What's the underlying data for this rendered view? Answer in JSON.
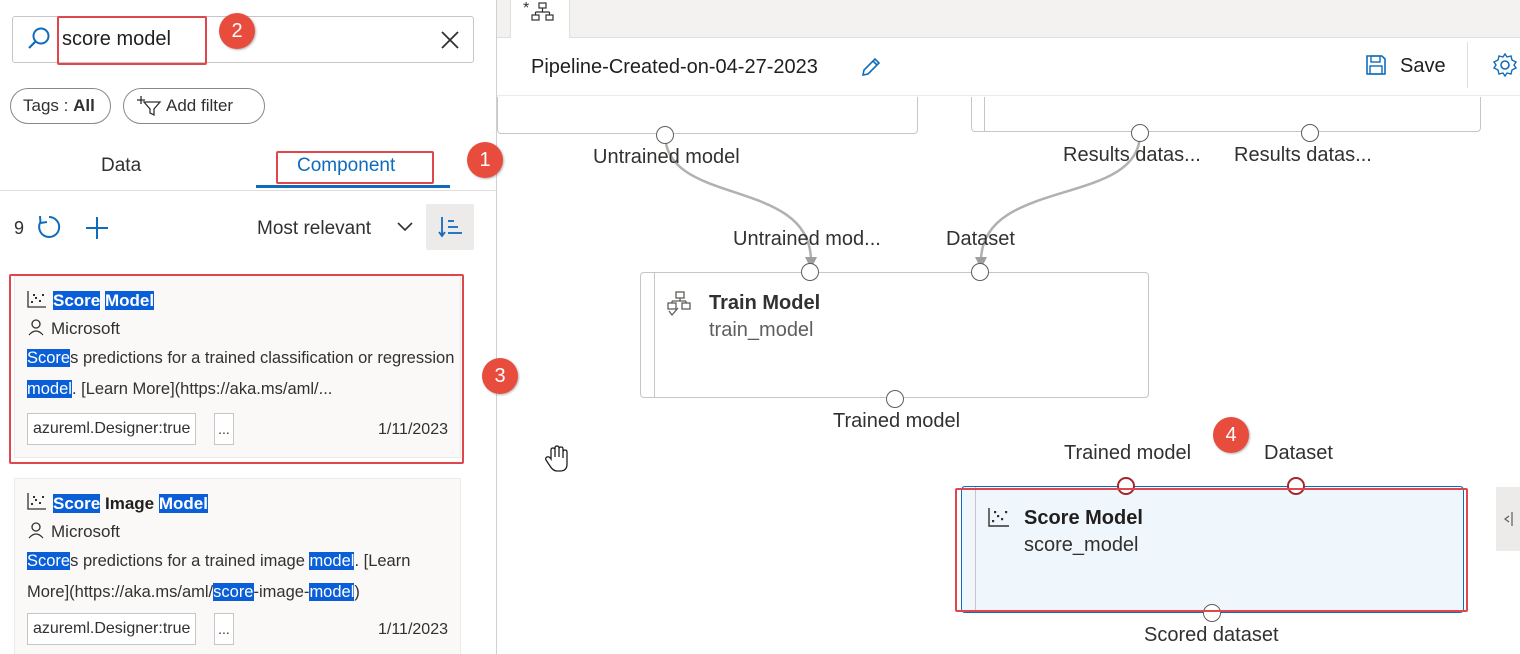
{
  "search": {
    "value": "score model"
  },
  "filters": {
    "tags_label": "Tags : ",
    "tags_value": "All",
    "add_filter": "Add filter"
  },
  "tabs": [
    {
      "label": "Data"
    },
    {
      "label": "Component"
    }
  ],
  "list_controls": {
    "count": "9",
    "sort": "Most relevant"
  },
  "cards": [
    {
      "title_parts": [
        "Score",
        "Model"
      ],
      "owner": "Microsoft",
      "desc": [
        {
          "t": "Score",
          "hl": true
        },
        {
          "t": "s predictions for a trained classification or regression ",
          "hl": false
        },
        {
          "t": "model",
          "hl": true
        },
        {
          "t": ". [Learn More](https://aka.ms/aml/...",
          "hl": false
        }
      ],
      "tag": "azureml.Designer:true",
      "more": "...",
      "date": "1/11/2023"
    },
    {
      "title_parts": [
        "Score",
        "Image",
        "Model"
      ],
      "owner": "Microsoft",
      "desc": [
        {
          "t": "Score",
          "hl": true
        },
        {
          "t": "s predictions for a trained image ",
          "hl": false
        },
        {
          "t": "model",
          "hl": true
        },
        {
          "t": ". [Learn More](https://aka.ms/aml/",
          "hl": false
        },
        {
          "t": "score",
          "hl": true
        },
        {
          "t": "-image-",
          "hl": false
        },
        {
          "t": "model",
          "hl": true
        },
        {
          "t": ")",
          "hl": false
        }
      ],
      "tag": "azureml.Designer:true",
      "more": "...",
      "date": "1/11/2023"
    }
  ],
  "badges": [
    "1",
    "2",
    "3",
    "4"
  ],
  "pipeline": {
    "title": "Pipeline-Created-on-04-27-2023",
    "save": "Save",
    "tab_prefix": "*"
  },
  "canvas": {
    "top_left_out": "Untrained model",
    "top_right_out1": "Results datas...",
    "top_right_out2": "Results datas...",
    "train": {
      "in1": "Untrained mod...",
      "in2": "Dataset",
      "title": "Train Model",
      "sub": "train_model",
      "out": "Trained model"
    },
    "score": {
      "in1": "Trained model",
      "in2": "Dataset",
      "title": "Score Model",
      "sub": "score_model",
      "out": "Scored dataset"
    }
  },
  "colors": {
    "accent": "#0f6cbd",
    "highlight": "#0a5fd8",
    "annotation": "#e74c3c"
  }
}
